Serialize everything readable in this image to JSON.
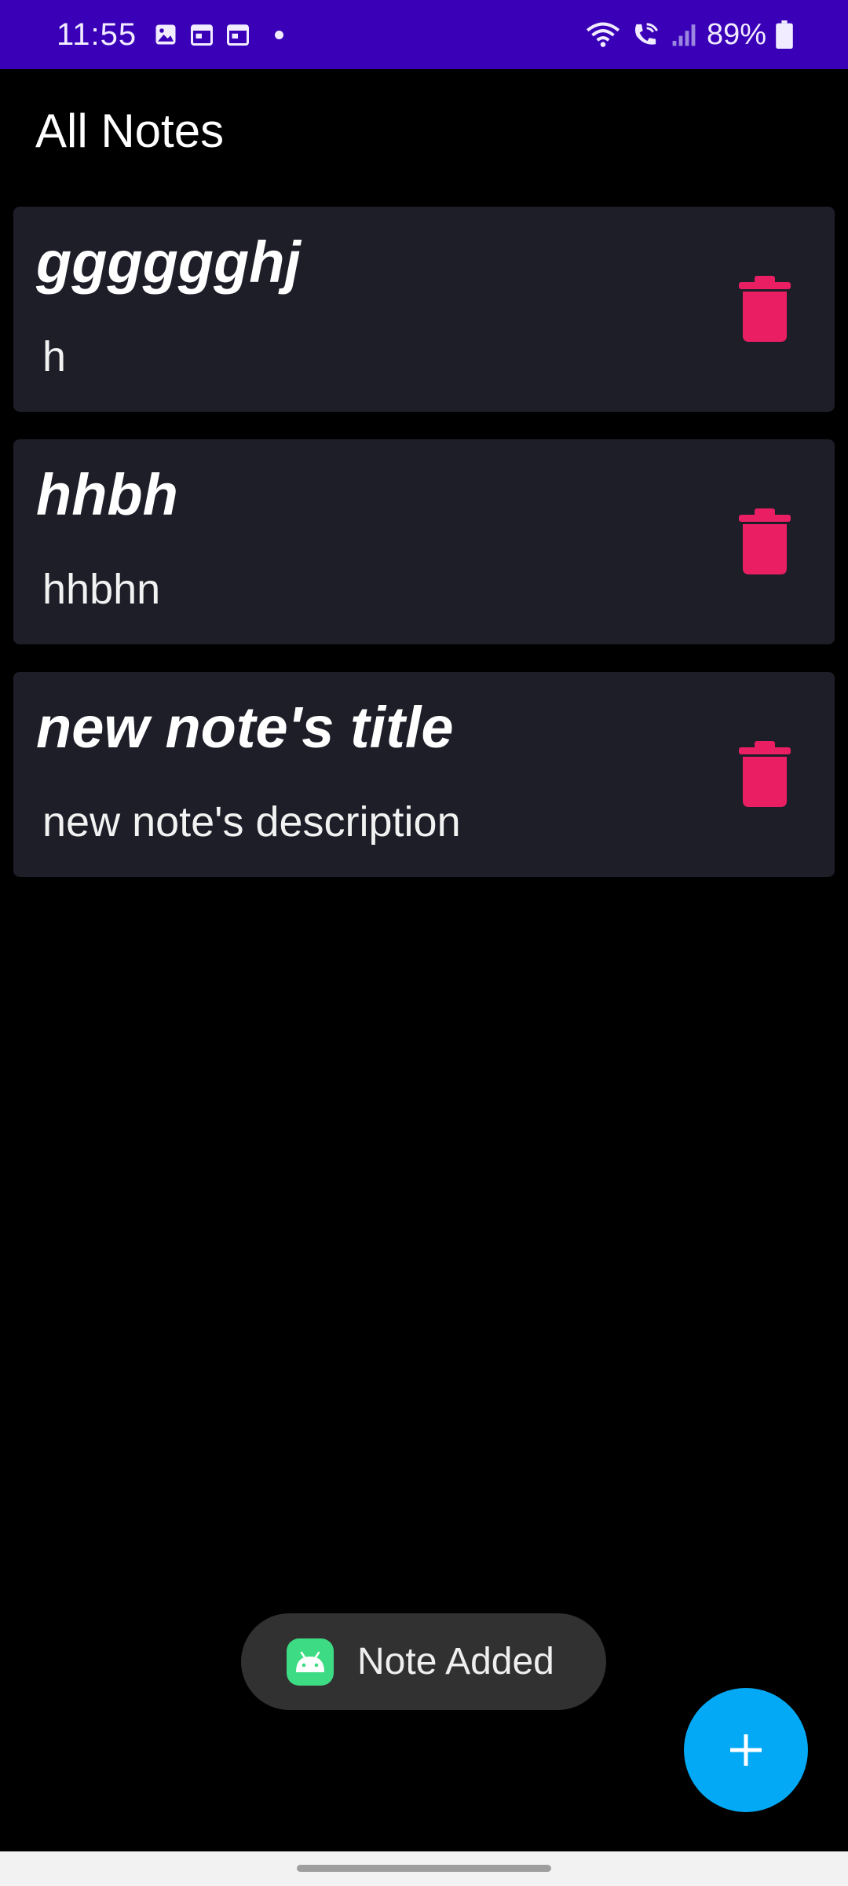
{
  "status_bar": {
    "time": "11:55",
    "battery": "89%",
    "left_icons": [
      "gallery-icon",
      "calendar-icon",
      "calendar-icon"
    ],
    "right_icons": [
      "wifi-icon",
      "wifi-call-icon",
      "signal-icon",
      "battery-icon"
    ]
  },
  "header": {
    "title": "All Notes"
  },
  "notes": [
    {
      "title": "gggggghj",
      "description": "h"
    },
    {
      "title": "hhbh",
      "description": "hhbhn"
    },
    {
      "title": "new note's title",
      "description": "new note's description"
    }
  ],
  "toast": {
    "message": "Note Added",
    "icon": "android-icon"
  },
  "fab": {
    "icon": "plus-icon"
  },
  "colors": {
    "status_bar": "#3a00b8",
    "card_bg": "#1e1e29",
    "delete_icon": "#e91e63",
    "fab": "#03a9f4",
    "toast_bg": "#313131"
  }
}
